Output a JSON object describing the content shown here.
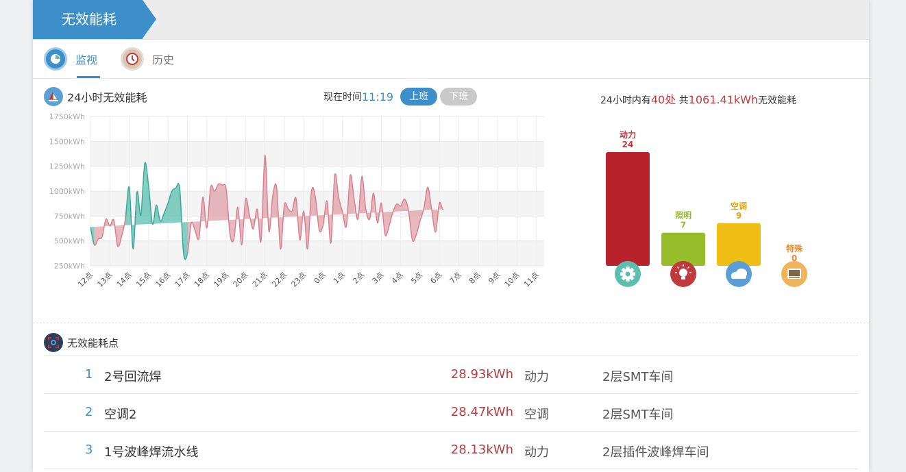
{
  "header": {
    "title": "无效能耗"
  },
  "tabs": [
    {
      "label": "监视",
      "active": true,
      "icon": "monitor-icon"
    },
    {
      "label": "历史",
      "active": false,
      "icon": "clock-icon"
    }
  ],
  "area_chart": {
    "title": "24小时无效能耗",
    "now_label": "现在时间",
    "now_time": "11:19",
    "on_shift": "上班",
    "off_shift": "下班",
    "chart_data": {
      "type": "area",
      "y_ticks": [
        "1750kWh",
        "1500kWh",
        "1250kWh",
        "1000kWh",
        "750kWh",
        "500kWh",
        "250kWh"
      ],
      "ylim": [
        250,
        1750
      ],
      "x_labels": [
        "12点",
        "13点",
        "14点",
        "15点",
        "16点",
        "17点",
        "18点",
        "19点",
        "20点",
        "21点",
        "22点",
        "23点",
        "0点",
        "1点",
        "2点",
        "3点",
        "4点",
        "5点",
        "6点",
        "7点",
        "8点",
        "9点",
        "10点",
        "11点"
      ],
      "x": [
        12.0,
        12.2,
        12.4,
        12.6,
        12.8,
        13.0,
        13.2,
        13.4,
        13.6,
        13.8,
        14.0,
        14.2,
        14.4,
        14.6,
        14.8,
        15.0,
        15.2,
        15.4,
        15.6,
        15.8,
        16.0,
        16.2,
        16.4,
        16.6,
        16.8,
        17.0,
        17.2,
        17.4,
        17.6,
        17.8,
        18.0,
        18.2,
        18.4,
        18.6,
        18.8,
        19.0,
        19.2,
        19.4,
        19.6,
        19.8,
        20.0,
        20.2,
        20.4,
        20.6,
        20.8,
        21.0,
        21.2,
        21.4,
        21.6,
        21.8,
        22.0,
        22.2,
        22.4,
        22.6,
        22.8,
        23.0,
        23.2,
        23.4,
        23.6,
        23.8,
        24.0,
        24.2,
        24.4,
        24.6,
        24.8,
        25.0,
        25.2,
        25.4,
        25.6,
        25.8,
        26.0,
        26.2,
        26.4,
        26.6,
        26.8,
        27.0,
        27.2,
        27.4,
        27.6,
        27.8,
        28.0,
        28.2,
        28.4,
        28.6,
        28.8,
        29.0,
        29.2,
        29.4,
        29.6,
        29.8,
        30.0,
        30.2,
        30.4,
        30.6,
        30.8,
        31.0,
        31.2,
        31.4,
        31.6,
        31.8,
        32.0,
        32.2,
        32.4,
        32.6,
        32.8,
        33.0,
        33.2,
        33.4,
        33.6,
        33.8,
        34.0,
        34.2,
        34.4,
        34.6,
        34.8,
        35.0,
        35.2,
        35.4
      ],
      "y": [
        640,
        460,
        520,
        540,
        720,
        650,
        710,
        450,
        540,
        720,
        1040,
        420,
        990,
        760,
        1280,
        1050,
        670,
        860,
        700,
        780,
        880,
        1000,
        1030,
        1030,
        380,
        370,
        680,
        600,
        530,
        940,
        630,
        1040,
        1000,
        1070,
        1060,
        1020,
        560,
        520,
        840,
        460,
        920,
        760,
        620,
        820,
        500,
        1360,
        600,
        950,
        1040,
        420,
        860,
        820,
        800,
        930,
        510,
        800,
        420,
        1000,
        940,
        610,
        660,
        900,
        480,
        1160,
        940,
        790,
        650,
        1160,
        920,
        720,
        1150,
        820,
        720,
        980,
        680,
        880,
        560,
        650,
        790,
        870,
        850,
        920,
        810,
        510,
        560,
        700,
        830,
        1040,
        810,
        590,
        880,
        820,
        1040
      ],
      "series": [
        {
          "name": "上班",
          "color": "#5bbfb0",
          "ranges": [
            [
              12.0,
              12.2
            ],
            [
              13.8,
              17.0
            ],
            [
              32.8,
              35.4
            ]
          ]
        },
        {
          "name": "下班",
          "color": "#e0a0aa",
          "ranges": [
            [
              12.2,
              13.8
            ],
            [
              17.0,
              32.8
            ]
          ]
        }
      ]
    }
  },
  "bar_chart": {
    "summary_prefix": "24小时内有",
    "summary_count": "40处",
    "summary_mid": "共",
    "summary_total": "1061.41kWh",
    "summary_suffix": "无效能耗",
    "chart_data": {
      "type": "bar",
      "categories": [
        "动力",
        "照明",
        "空调",
        "特殊"
      ],
      "values": [
        24,
        7,
        9,
        0
      ],
      "colors": [
        "#b8232b",
        "#97bd2a",
        "#eebe14",
        "#e8892d"
      ],
      "label_colors": [
        "#c0393d",
        "#97bd2a",
        "#e0a814",
        "#e8892d"
      ],
      "icons": [
        "gear-icon",
        "lightbulb-icon",
        "cloud-icon",
        "monitor-icon"
      ],
      "icon_colors": [
        "#5bbfb0",
        "#c0393d",
        "#5aa0d6",
        "#f0b45a"
      ],
      "ylim": [
        0,
        24
      ]
    }
  },
  "list": {
    "title": "无效能耗点",
    "rows": [
      {
        "idx": "1",
        "name": "2号回流焊",
        "value": "28.93kWh",
        "type": "动力",
        "location": "2层SMT车间"
      },
      {
        "idx": "2",
        "name": "空调2",
        "value": "28.47kWh",
        "type": "空调",
        "location": "2层SMT车间"
      },
      {
        "idx": "3",
        "name": "1号波峰焊流水线",
        "value": "28.13kWh",
        "type": "动力",
        "location": "2层插件波峰焊车间"
      }
    ]
  }
}
